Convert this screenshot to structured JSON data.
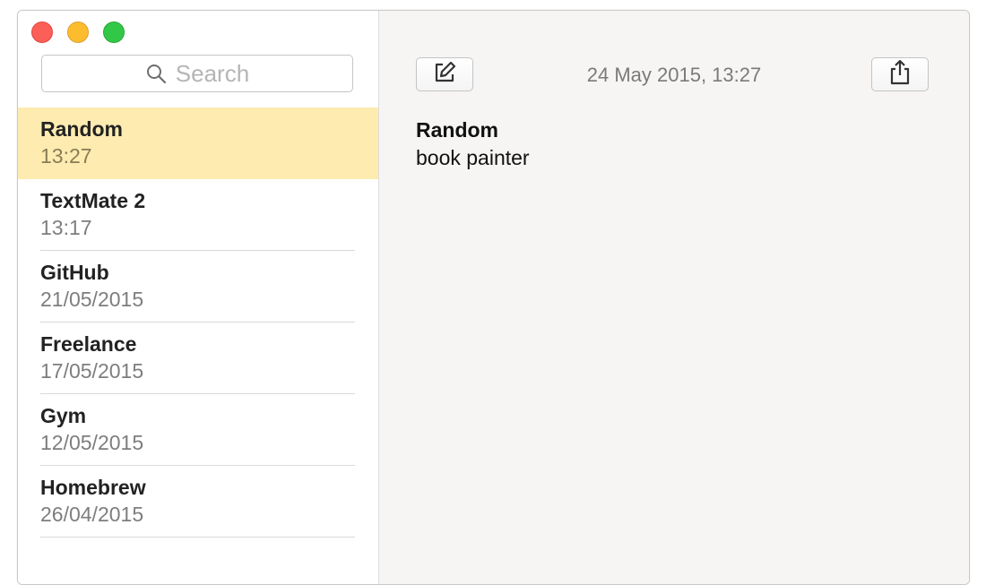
{
  "search": {
    "placeholder": "Search"
  },
  "notes": [
    {
      "title": "Random",
      "date": "13:27",
      "selected": true
    },
    {
      "title": "TextMate 2",
      "date": "13:17"
    },
    {
      "title": "GitHub",
      "date": "21/05/2015"
    },
    {
      "title": "Freelance",
      "date": "17/05/2015"
    },
    {
      "title": "Gym",
      "date": "12/05/2015"
    },
    {
      "title": "Homebrew",
      "date": "26/04/2015"
    }
  ],
  "editor": {
    "timestamp": "24 May 2015, 13:27",
    "title": "Random",
    "body": "book painter"
  },
  "colors": {
    "selected_row": "#fdebb0",
    "close": "#fc5f57",
    "minimize": "#fdbc2e",
    "zoom": "#33c748"
  },
  "icons": {
    "compose": "compose-icon",
    "share": "share-icon",
    "search": "search-icon"
  }
}
